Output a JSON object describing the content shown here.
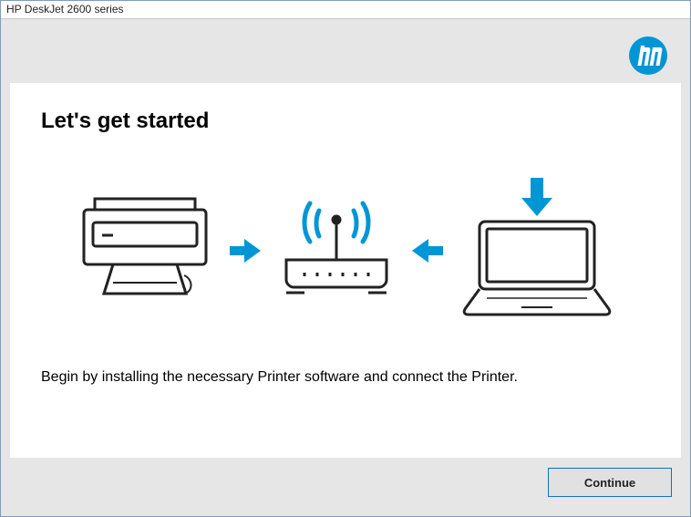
{
  "window": {
    "title": "HP DeskJet 2600 series"
  },
  "brand": {
    "logo_aria": "HP logo",
    "accent": "#0096d6"
  },
  "main": {
    "heading": "Let's get started",
    "description": "Begin by installing the necessary Printer software and connect the Printer."
  },
  "icons": {
    "printer": "printer-icon",
    "arrow_right": "arrow-right-icon",
    "router": "router-icon",
    "arrow_left": "arrow-left-icon",
    "laptop": "laptop-icon",
    "arrow_down": "arrow-down-icon"
  },
  "footer": {
    "continue_label": "Continue"
  }
}
